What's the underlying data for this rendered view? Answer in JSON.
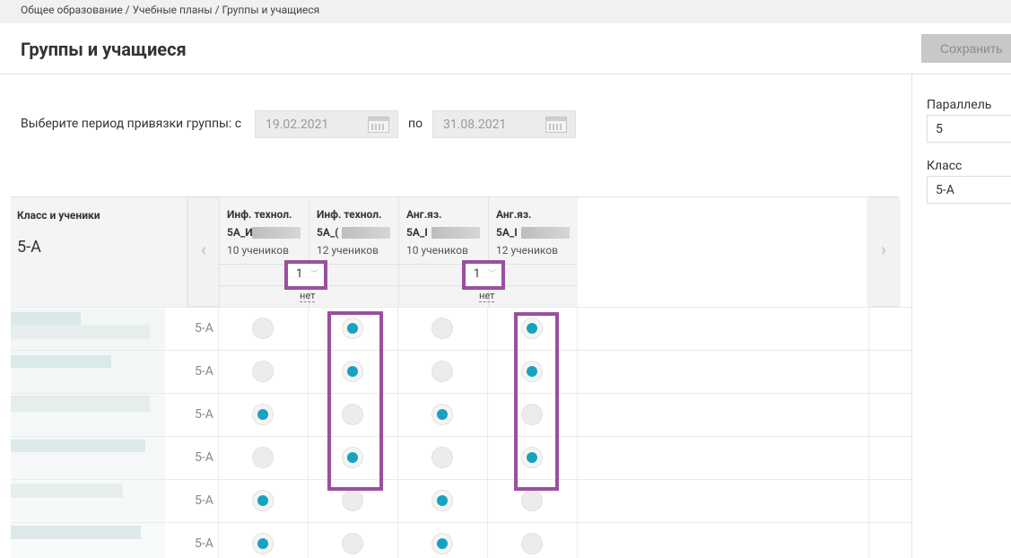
{
  "breadcrumb": "Общее образование / Учебные планы / Группы и учащиеся",
  "header": {
    "title": "Группы и учащиеся",
    "save_label": "Сохранить"
  },
  "period": {
    "label": "Выберите период привязки группы: с",
    "from": "19.02.2021",
    "to_label": "по",
    "to": "31.08.2021"
  },
  "filters": {
    "parallel_label": "Параллель",
    "parallel_value": "5",
    "class_label": "Класс",
    "class_value": "5-А"
  },
  "table": {
    "class_header": "Класс и ученики",
    "class_name": "5-А",
    "prev_icon": "‹",
    "next_icon": "›",
    "groups": [
      {
        "subject": "Инф. технол.",
        "code": "5А_И",
        "count": "10 учеников"
      },
      {
        "subject": "Инф. технол.",
        "code": "5А_(",
        "count": "12 учеников"
      },
      {
        "subject": "Анг.яз.",
        "code": "5А_I",
        "count": "10 учеников"
      },
      {
        "subject": "Анг.яз.",
        "code": "5А_I",
        "count": "12 учеников"
      }
    ],
    "subgroup_selects": [
      {
        "value": "1"
      },
      {
        "value": "1"
      }
    ],
    "net_labels": [
      "нет",
      "нет"
    ],
    "rows": [
      {
        "class": "5-А",
        "selected": [
          false,
          true,
          false,
          true
        ]
      },
      {
        "class": "5-А",
        "selected": [
          false,
          true,
          false,
          true
        ]
      },
      {
        "class": "5-А",
        "selected": [
          true,
          false,
          true,
          false
        ]
      },
      {
        "class": "5-А",
        "selected": [
          false,
          true,
          false,
          true
        ]
      },
      {
        "class": "5-А",
        "selected": [
          true,
          false,
          true,
          false
        ]
      },
      {
        "class": "5-А",
        "selected": [
          true,
          false,
          true,
          false
        ]
      }
    ],
    "accent_color": "#17a2c0",
    "highlight_color": "#9b4f9f"
  }
}
